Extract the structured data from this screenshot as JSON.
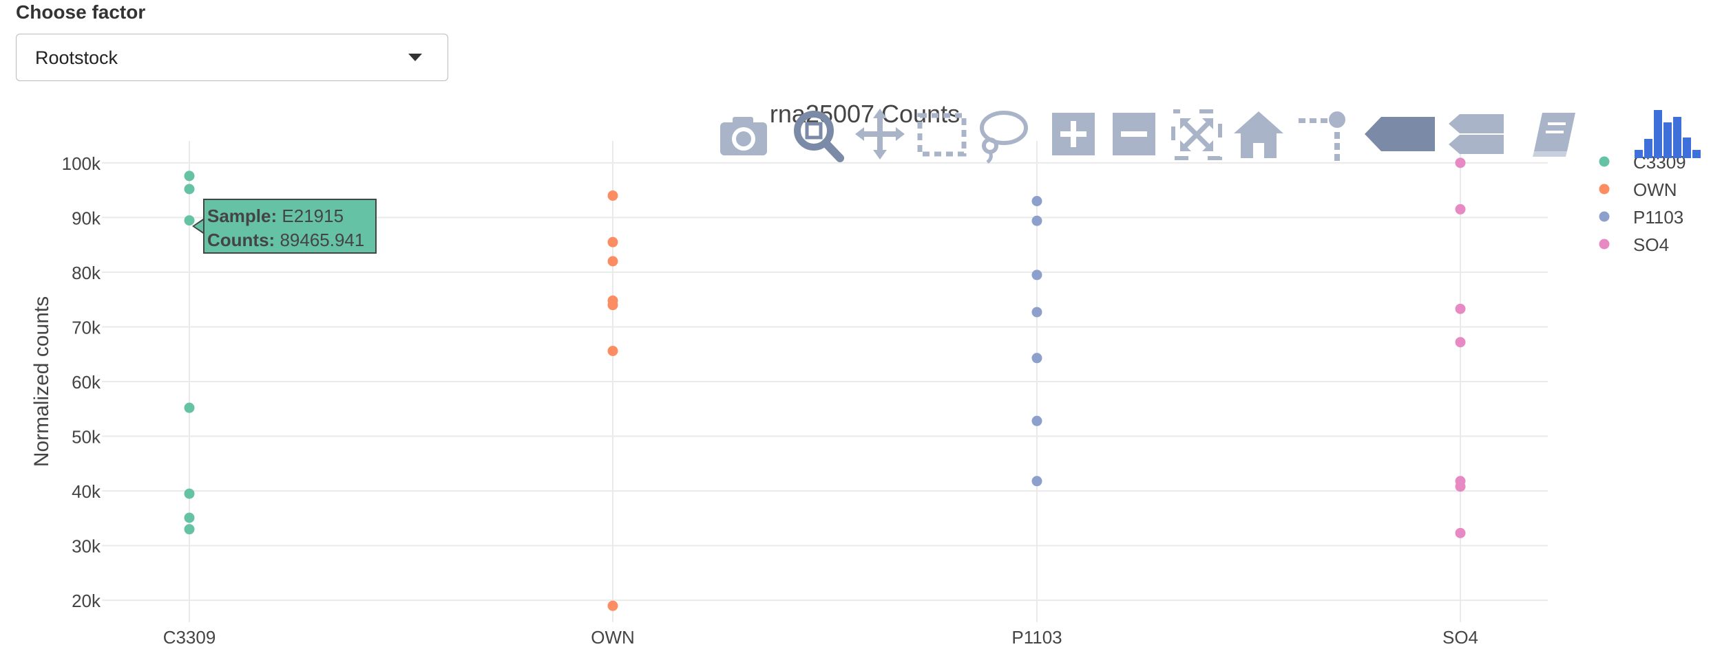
{
  "factor_select": {
    "label": "Choose factor",
    "selected": "Rootstock"
  },
  "modebar": {
    "buttons": [
      {
        "name": "camera-icon",
        "label": "Download plot as a png"
      },
      {
        "name": "zoom-icon",
        "label": "Zoom",
        "active": true
      },
      {
        "name": "pan-icon",
        "label": "Pan"
      },
      {
        "name": "box-select-icon",
        "label": "Box Select"
      },
      {
        "name": "lasso-select-icon",
        "label": "Lasso Select"
      },
      {
        "name": "zoom-in-icon",
        "label": "Zoom in"
      },
      {
        "name": "zoom-out-icon",
        "label": "Zoom out"
      },
      {
        "name": "autoscale-icon",
        "label": "Autoscale"
      },
      {
        "name": "reset-axes-icon",
        "label": "Reset axes"
      },
      {
        "name": "spike-lines-icon",
        "label": "Toggle Spike Lines"
      },
      {
        "name": "hover-closest-icon",
        "label": "Show closest data on hover"
      },
      {
        "name": "hover-compare-icon",
        "label": "Compare data on hover"
      },
      {
        "name": "edit-chart-studio-icon",
        "label": "Edit in Chart Studio"
      },
      {
        "name": "plotly-logo-icon",
        "label": "Produced with Plotly"
      }
    ]
  },
  "tooltip": {
    "sample_label": "Sample:",
    "sample_value": "E21915",
    "counts_label": "Counts:",
    "counts_value": "89465.941"
  },
  "chart_data": {
    "type": "scatter",
    "title": "rna25007 Counts",
    "xlabel": "",
    "ylabel": "Normalized counts",
    "categories": [
      "C3309",
      "OWN",
      "P1103",
      "SO4"
    ],
    "y_tick_values": [
      20000,
      30000,
      40000,
      50000,
      60000,
      70000,
      80000,
      90000,
      100000
    ],
    "y_tick_labels": [
      "20k",
      "30k",
      "40k",
      "50k",
      "60k",
      "70k",
      "80k",
      "90k",
      "100k"
    ],
    "ylim": [
      16000,
      104000
    ],
    "grid": true,
    "legend_placement": "top-right",
    "series": [
      {
        "name": "C3309",
        "category": "C3309",
        "color": "#66c2a5",
        "values": [
          97600,
          95200,
          89465.941,
          55200,
          39500,
          35100,
          33000
        ]
      },
      {
        "name": "OWN",
        "category": "OWN",
        "color": "#fc8d62",
        "values": [
          94000,
          85500,
          82000,
          74800,
          74000,
          65600,
          19000
        ]
      },
      {
        "name": "P1103",
        "category": "P1103",
        "color": "#8da0cb",
        "values": [
          93000,
          89400,
          79500,
          72700,
          64300,
          52800,
          41800
        ]
      },
      {
        "name": "SO4",
        "category": "SO4",
        "color": "#e78ac3",
        "values": [
          100000,
          91500,
          73300,
          67200,
          41800,
          40800,
          32300
        ]
      }
    ]
  }
}
